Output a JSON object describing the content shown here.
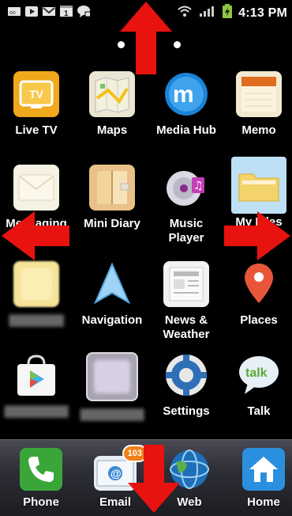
{
  "status_bar": {
    "time": "4:13 PM",
    "icons": [
      "voicemail-icon",
      "youtube-icon",
      "gmail-icon",
      "calendar-icon",
      "talk-icon"
    ],
    "calendar_day": "1"
  },
  "home_screen": {
    "apps": [
      {
        "id": "live-tv",
        "label": "Live TV",
        "icon": "tv-icon",
        "color": "#f0a81c",
        "blurred": false
      },
      {
        "id": "maps",
        "label": "Maps",
        "icon": "map-icon",
        "color": "#e9e6d4",
        "blurred": false
      },
      {
        "id": "media-hub",
        "label": "Media Hub",
        "icon": "media-hub-icon",
        "color": "#1a83d6",
        "blurred": false
      },
      {
        "id": "memo",
        "label": "Memo",
        "icon": "memo-icon",
        "color": "#f2e9d0",
        "blurred": false
      },
      {
        "id": "messaging",
        "label": "Messaging",
        "icon": "envelope-icon",
        "color": "#f5f2e4",
        "blurred": false
      },
      {
        "id": "mini-diary",
        "label": "Mini Diary",
        "icon": "diary-icon",
        "color": "#e8c08a",
        "blurred": false
      },
      {
        "id": "music-player",
        "label": "Music\nPlayer",
        "icon": "music-disc-icon",
        "color": "#d8d8e0",
        "blurred": false
      },
      {
        "id": "my-files",
        "label": "My Files",
        "icon": "folder-icon",
        "color": "#bde0f5",
        "blurred": false
      },
      {
        "id": "blurred-app-1",
        "label": "",
        "icon": "blurred-app-icon",
        "color": "#f6e39a",
        "blurred": true
      },
      {
        "id": "navigation",
        "label": "Navigation",
        "icon": "navigation-arrow-icon",
        "color": "#8cc8f5",
        "blurred": false
      },
      {
        "id": "news-weather",
        "label": "News &\nWeather",
        "icon": "news-icon",
        "color": "#f2f2f2",
        "blurred": false
      },
      {
        "id": "places",
        "label": "Places",
        "icon": "map-pin-icon",
        "color": "#e8563a",
        "blurred": false
      },
      {
        "id": "play-store",
        "label": "",
        "icon": "play-store-bag-icon",
        "color": "#f4f4f4",
        "blurred": true
      },
      {
        "id": "blurred-app-2",
        "label": "",
        "icon": "blurred-app-icon",
        "color": "#c9bfd4",
        "blurred": true
      },
      {
        "id": "settings",
        "label": "Settings",
        "icon": "gear-icon",
        "color": "#2f6fb8",
        "blurred": false
      },
      {
        "id": "talk",
        "label": "Talk",
        "icon": "talk-bubble-icon",
        "color": "#e6f0f6",
        "blurred": false
      }
    ]
  },
  "dock": {
    "apps": [
      {
        "id": "phone",
        "label": "Phone",
        "icon": "phone-icon",
        "color": "#3aa63a"
      },
      {
        "id": "email",
        "label": "Email",
        "icon": "email-icon",
        "color": "#e8eef5",
        "badge": "103"
      },
      {
        "id": "web",
        "label": "Web",
        "icon": "globe-icon",
        "color": "#1d6fb8"
      },
      {
        "id": "home",
        "label": "Home",
        "icon": "home-icon",
        "color": "#2b8fe0"
      }
    ]
  },
  "overlay": {
    "arrow_color": "#e8120f",
    "arrows": [
      "arrow-up-icon",
      "arrow-left-icon",
      "arrow-right-icon",
      "arrow-down-icon"
    ]
  }
}
